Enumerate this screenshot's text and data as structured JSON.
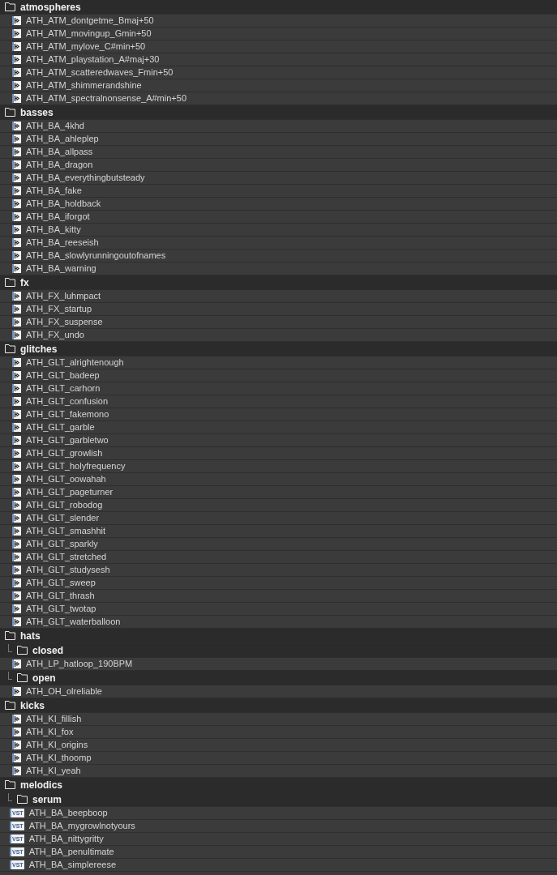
{
  "tree": [
    {
      "kind": "folder",
      "name": "atmospheres",
      "children": [
        {
          "kind": "audio",
          "name": "ATH_ATM_dontgetme_Bmaj+50"
        },
        {
          "kind": "audio",
          "name": "ATH_ATM_movingup_Gmin+50"
        },
        {
          "kind": "audio",
          "name": "ATH_ATM_mylove_C#min+50"
        },
        {
          "kind": "audio",
          "name": "ATH_ATM_playstation_A#maj+30"
        },
        {
          "kind": "audio",
          "name": "ATH_ATM_scatteredwaves_Fmin+50"
        },
        {
          "kind": "audio",
          "name": "ATH_ATM_shimmerandshine"
        },
        {
          "kind": "audio",
          "name": "ATH_ATM_spectralnonsense_A#min+50"
        }
      ]
    },
    {
      "kind": "folder",
      "name": "basses",
      "children": [
        {
          "kind": "audio",
          "name": "ATH_BA_4khd"
        },
        {
          "kind": "audio",
          "name": "ATH_BA_ahleplep"
        },
        {
          "kind": "audio",
          "name": "ATH_BA_allpass"
        },
        {
          "kind": "audio",
          "name": "ATH_BA_dragon"
        },
        {
          "kind": "audio",
          "name": "ATH_BA_everythingbutsteady"
        },
        {
          "kind": "audio",
          "name": "ATH_BA_fake"
        },
        {
          "kind": "audio",
          "name": "ATH_BA_holdback"
        },
        {
          "kind": "audio",
          "name": "ATH_BA_iforgot"
        },
        {
          "kind": "audio",
          "name": "ATH_BA_kitty"
        },
        {
          "kind": "audio",
          "name": "ATH_BA_reeseish"
        },
        {
          "kind": "audio",
          "name": "ATH_BA_slowlyrunningoutofnames"
        },
        {
          "kind": "audio",
          "name": "ATH_BA_warning"
        }
      ]
    },
    {
      "kind": "folder",
      "name": "fx",
      "children": [
        {
          "kind": "audio",
          "name": "ATH_FX_luhmpact"
        },
        {
          "kind": "audio",
          "name": "ATH_FX_startup"
        },
        {
          "kind": "audio",
          "name": "ATH_FX_suspense"
        },
        {
          "kind": "audio",
          "name": "ATH_FX_undo"
        }
      ]
    },
    {
      "kind": "folder",
      "name": "glitches",
      "children": [
        {
          "kind": "audio",
          "name": "ATH_GLT_alrightenough"
        },
        {
          "kind": "audio",
          "name": "ATH_GLT_badeep"
        },
        {
          "kind": "audio",
          "name": "ATH_GLT_carhorn"
        },
        {
          "kind": "audio",
          "name": "ATH_GLT_confusion"
        },
        {
          "kind": "audio",
          "name": "ATH_GLT_fakemono"
        },
        {
          "kind": "audio",
          "name": "ATH_GLT_garble"
        },
        {
          "kind": "audio",
          "name": "ATH_GLT_garbletwo"
        },
        {
          "kind": "audio",
          "name": "ATH_GLT_growlish"
        },
        {
          "kind": "audio",
          "name": "ATH_GLT_holyfrequency"
        },
        {
          "kind": "audio",
          "name": "ATH_GLT_oowahah"
        },
        {
          "kind": "audio",
          "name": "ATH_GLT_pageturner"
        },
        {
          "kind": "audio",
          "name": "ATH_GLT_robodog"
        },
        {
          "kind": "audio",
          "name": "ATH_GLT_slender"
        },
        {
          "kind": "audio",
          "name": "ATH_GLT_smashhit"
        },
        {
          "kind": "audio",
          "name": "ATH_GLT_sparkly"
        },
        {
          "kind": "audio",
          "name": "ATH_GLT_stretched"
        },
        {
          "kind": "audio",
          "name": "ATH_GLT_studysesh"
        },
        {
          "kind": "audio",
          "name": "ATH_GLT_sweep"
        },
        {
          "kind": "audio",
          "name": "ATH_GLT_thrash"
        },
        {
          "kind": "audio",
          "name": "ATH_GLT_twotap"
        },
        {
          "kind": "audio",
          "name": "ATH_GLT_waterballoon"
        }
      ]
    },
    {
      "kind": "folder",
      "name": "hats",
      "children": [
        {
          "kind": "folder",
          "name": "closed",
          "children": [
            {
              "kind": "audio",
              "name": "ATH_LP_hatloop_190BPM"
            }
          ]
        },
        {
          "kind": "folder",
          "name": "open",
          "children": [
            {
              "kind": "audio",
              "name": "ATH_OH_olreliable"
            }
          ]
        }
      ]
    },
    {
      "kind": "folder",
      "name": "kicks",
      "children": [
        {
          "kind": "audio",
          "name": "ATH_KI_fillish"
        },
        {
          "kind": "audio",
          "name": "ATH_KI_fox"
        },
        {
          "kind": "audio",
          "name": "ATH_KI_origins"
        },
        {
          "kind": "audio",
          "name": "ATH_KI_thoomp"
        },
        {
          "kind": "audio",
          "name": "ATH_KI_yeah"
        }
      ]
    },
    {
      "kind": "folder",
      "name": "melodics",
      "children": [
        {
          "kind": "folder",
          "name": "serum",
          "children": [
            {
              "kind": "vst",
              "badge": "VST",
              "name": "ATH_BA_beepboop"
            },
            {
              "kind": "vst",
              "badge": "VST",
              "name": "ATH_BA_mygrowlnotyours"
            },
            {
              "kind": "vst",
              "badge": "VST",
              "name": "ATH_BA_nittygritty"
            },
            {
              "kind": "vst",
              "badge": "VST",
              "name": "ATH_BA_penultimate"
            },
            {
              "kind": "vst",
              "badge": "VST",
              "name": "ATH_BA_simplereese"
            }
          ]
        }
      ]
    }
  ]
}
